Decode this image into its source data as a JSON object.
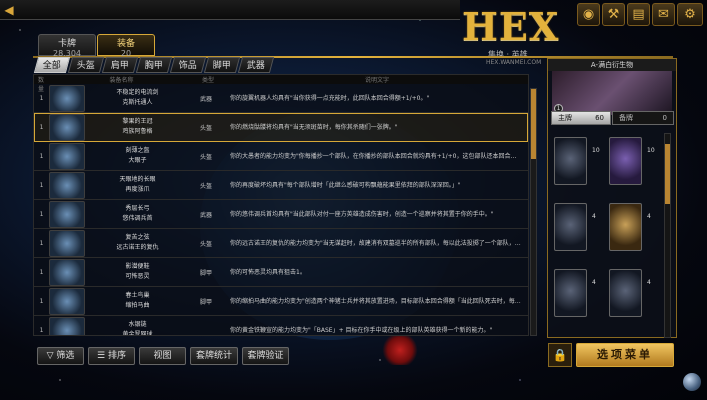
{
  "header": {
    "logo_text": "HEX",
    "logo_sub": "集换 · 英雄",
    "logo_url": "HEX.WANMEI.COM",
    "icons": [
      "gold-coin-icon",
      "hammer-icon",
      "book-icon",
      "scroll-icon",
      "gear-icon"
    ]
  },
  "main_tabs": [
    {
      "label": "卡牌",
      "count": "28,304",
      "active": false
    },
    {
      "label": "装备",
      "count": "20",
      "active": true
    }
  ],
  "categories": [
    "全部",
    "头盔",
    "肩甲",
    "胸甲",
    "饰品",
    "脚甲",
    "武器"
  ],
  "table": {
    "columns": [
      "数量",
      "装备名称",
      "类型",
      "说明文字"
    ],
    "rows": [
      {
        "num": "1",
        "name1": "不稳定的电流剑",
        "name2": "克斯托通人",
        "type": "武器",
        "text": "你的旋翼机器人均具有\"当你获得一点充能时，此回队本回合得额+1/+0。\""
      },
      {
        "num": "1",
        "name1": "黎果的王冠",
        "name2": "鸡族阿鲁格",
        "type": "头盔",
        "text": "你的燃烧骷髅将均具有\"当无须斑苗时，每你其杀随们一张牌。\""
      },
      {
        "num": "1",
        "name1": "刻薄之盔",
        "name2": "大眼子",
        "type": "头盔",
        "text": "你的大愚者的能力均变为\"你每播抄一个部队，在你播抄的部队本回合就均具有+1/+0，这包部队还本回合还具有勇猛。\""
      },
      {
        "num": "1",
        "name1": "天眼地的长眼",
        "name2": "再度涨爪",
        "type": "头盔",
        "text": "你的再度破坏均具有\"每个部队增时「此继么感破可构飘蕴能果里依拜的部队深深回。」\""
      },
      {
        "num": "1",
        "name1": "秀层长弓",
        "name2": "悠伟调兵首",
        "type": "武器",
        "text": "你的悠伟调兵首均具有\"当此部队对付一座方英雄造成伤害时，创造一个巡察并将其置于你的手中。\""
      },
      {
        "num": "1",
        "name1": "复苦之弦",
        "name2": "远古诺王的复仇",
        "type": "头盔",
        "text": "你的远古诺王的复仇的能力均变为\"当无谋赶时，故建消有双墓巡半的所有部队，每以此法投掷了一个部队，你在此牌上放置一个灵魂指示物。\""
      },
      {
        "num": "1",
        "name1": "影潜便鞋",
        "name2": "可怖恶灵",
        "type": "脚甲",
        "text": "你的可怖恶灵均具有狙击1。"
      },
      {
        "num": "1",
        "name1": "春土鸟巢",
        "name2": "缩拍马曲",
        "type": "脚甲",
        "text": "你的缩拍马曲的能力均变为\"创造两个神猪士兵并将其放置进场，目标部队本回合得额「当此回队死去时，每个敌方神猪士兵本回合得额+1/+1」。\"每此放置，你每播抄一个神猪士兵，就对某个部队造成伤害。\""
      },
      {
        "num": "1",
        "name1": "水银链",
        "name2": "黄金罗网球",
        "type": "",
        "text": "你的黄金铁鞭宣的能力均变为\"「BASE」+ 目标在你手中或在级上的部队英雄获得一个新的能力。\""
      }
    ]
  },
  "bottom_buttons": [
    "筛选",
    "排序",
    "视图",
    "套牌统计",
    "套牌验证"
  ],
  "right_panel": {
    "title": "A-满白衍生物",
    "portrait_badge": "1",
    "deck_tab_main": "主牌",
    "deck_tab_main_count": "60",
    "deck_tab_reserve": "备牌",
    "deck_tab_reserve_count": "0",
    "cards": [
      {
        "count": "10"
      },
      {
        "count": "10"
      },
      {
        "count": "4"
      },
      {
        "count": "4"
      },
      {
        "count": "4"
      },
      {
        "count": "4"
      }
    ]
  },
  "options_label": "选项菜单"
}
